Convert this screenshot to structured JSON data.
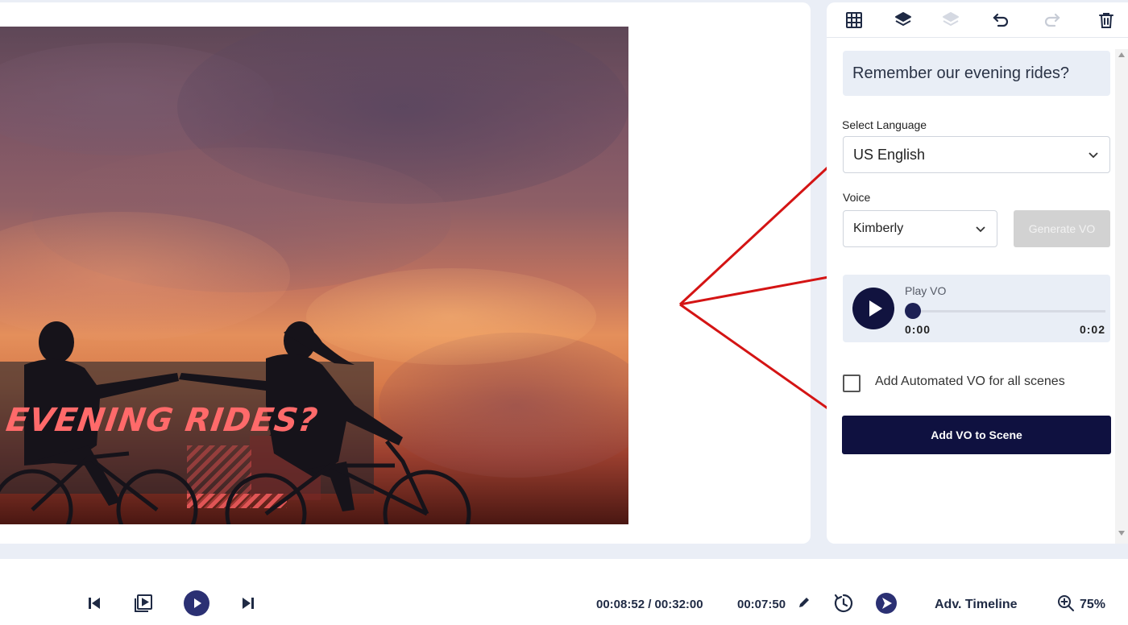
{
  "scene": {
    "caption": "EVENING RIDES?"
  },
  "toolbar": {
    "icons": [
      "grid-icon",
      "layers-icon",
      "layers-disabled-icon",
      "undo-icon",
      "redo-disabled-icon",
      "trash-icon"
    ]
  },
  "panel": {
    "scene_text": "Remember our evening rides?",
    "language_label": "Select Language",
    "language_value": "US English",
    "voice_label": "Voice",
    "voice_value": "Kimberly",
    "generate_label": "Generate VO",
    "player": {
      "label": "Play VO",
      "time_start": "0:00",
      "time_end": "0:02",
      "progress": 0
    },
    "auto_vo_label": "Add Automated VO for all scenes",
    "auto_vo_checked": false,
    "add_vo_label": "Add VO to Scene"
  },
  "bottom": {
    "elapsed_total": "00:08:52 / 00:32:00",
    "scene_duration": "00:07:50",
    "adv_timeline": "Adv. Timeline",
    "zoom": "75%"
  },
  "colors": {
    "primary_dark": "#0f1140",
    "annotation_arrow": "#d41414",
    "panel_field_bg": "#e9eef6",
    "disabled_button": "#d2d2d2"
  }
}
